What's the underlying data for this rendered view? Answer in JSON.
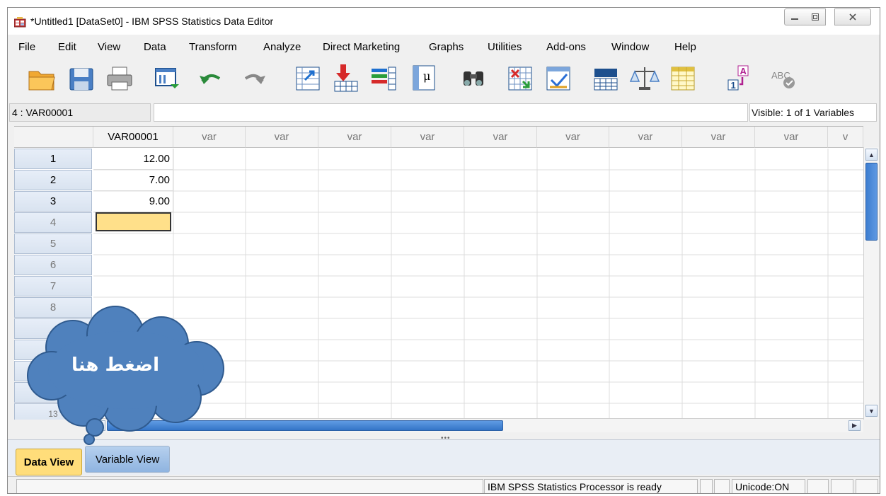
{
  "window": {
    "title": "*Untitled1 [DataSet0] - IBM SPSS Statistics Data Editor"
  },
  "menu": [
    {
      "label": "File"
    },
    {
      "label": "Edit"
    },
    {
      "label": "View"
    },
    {
      "label": "Data"
    },
    {
      "label": "Transform"
    },
    {
      "label": "Analyze"
    },
    {
      "label": "Direct Marketing"
    },
    {
      "label": "Graphs"
    },
    {
      "label": "Utilities"
    },
    {
      "label": "Add-ons"
    },
    {
      "label": "Window"
    },
    {
      "label": "Help"
    }
  ],
  "toolbar": {
    "icons": [
      "open-folder-icon",
      "save-icon",
      "print-icon",
      "dialog-recall-icon",
      "undo-icon",
      "redo-icon",
      "goto-case-icon",
      "goto-variable-icon",
      "variables-icon",
      "descriptives-icon",
      "find-icon",
      "insert-cases-icon",
      "insert-variable-icon",
      "split-file-icon",
      "weight-cases-icon",
      "select-cases-icon",
      "value-labels-icon",
      "spell-check-icon"
    ],
    "value_labels_glyph_top": "A",
    "value_labels_glyph_bottom": "1",
    "spell_glyph": "ABC",
    "mu_glyph": "μ"
  },
  "cell_ref": "4 : VAR00001",
  "cell_editor_value": "",
  "visible_info": "Visible: 1 of 1 Variables",
  "grid": {
    "columns": [
      "VAR00001",
      "var",
      "var",
      "var",
      "var",
      "var",
      "var",
      "var",
      "var",
      "var",
      "v"
    ],
    "rows": [
      "1",
      "2",
      "3",
      "4",
      "5",
      "6",
      "7",
      "8",
      "",
      "",
      "",
      "",
      "13"
    ],
    "values": [
      "12.00",
      "7.00",
      "9.00"
    ]
  },
  "tabs": {
    "data_view": "Data View",
    "variable_view": "Variable View"
  },
  "status": {
    "processor": "IBM SPSS Statistics Processor is ready",
    "unicode": "Unicode:ON"
  },
  "callout": {
    "text": "اضغط هنا"
  },
  "colors": {
    "callout_fill": "#4f81bd",
    "active_cell": "#ffe08a",
    "data_view_tab": "#ffdd7a",
    "scroll_thumb": "#3d7dd0"
  }
}
